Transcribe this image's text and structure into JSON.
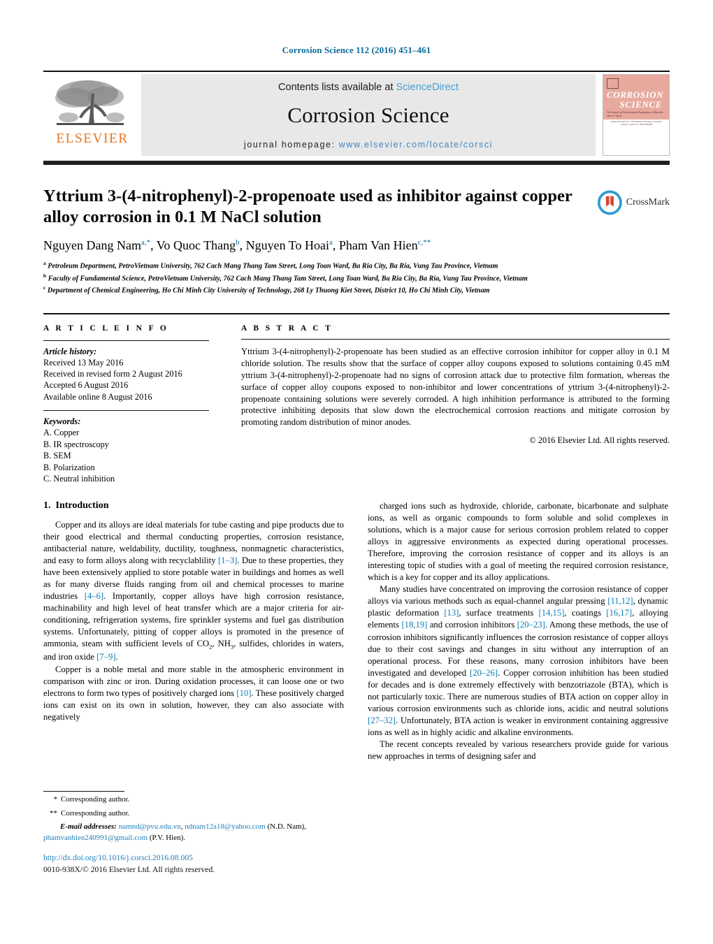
{
  "running_head": "Corrosion Science 112 (2016) 451–461",
  "masthead": {
    "publisher_name": "ELSEVIER",
    "contents_prefix": "Contents lists available at ",
    "contents_link": "ScienceDirect",
    "journal_name": "Corrosion Science",
    "homepage_label": "journal homepage: ",
    "homepage_url": "www.elsevier.com/locate/corsci",
    "cover": {
      "title_line1": "CORROSION",
      "title_line2": "SCIENCE",
      "subtitle": "The Journal on Environmental Degradation of Materials and its Control",
      "editors": "Editors-in-Chief: R.C. NEWMAN, University of Toronto, Canada, Canada   A.J. DAVENPORT"
    }
  },
  "article": {
    "title": "Yttrium 3-(4-nitrophenyl)-2-propenoate used as inhibitor against copper alloy corrosion in 0.1 M NaCl solution",
    "crossmark_label": "CrossMark",
    "authors_html": "Nguyen Dang Nam<sup>a,*</sup>, Vo Quoc Thang<sup>b</sup>, Nguyen To Hoai<sup>a</sup>, Pham Van Hien<sup>c,**</sup>",
    "affiliations": [
      "Petroleum Department, PetroVietnam University, 762 Cach Mang Thang Tam Street, Long Toan Ward, Ba Ria City, Ba Ria, Vung Tau Province, Vietnam",
      "Faculty of Fundamental Science, PetroVietnam University, 762 Cach Mang Thang Tam Street, Long Toan Ward, Ba Ria City, Ba Ria, Vung Tau Province, Vietnam",
      "Department of Chemical Engineering, Ho Chi Minh City University of Technology, 268 Ly Thuong Kiet Street, District 10, Ho Chi Minh City, Vietnam"
    ],
    "affiliation_marks": [
      "a",
      "b",
      "c"
    ]
  },
  "article_info": {
    "heading": "A R T I C L E   I N F O",
    "history_label": "Article history:",
    "history": [
      "Received 13 May 2016",
      "Received in revised form 2 August 2016",
      "Accepted 6 August 2016",
      "Available online 8 August 2016"
    ],
    "keywords_label": "Keywords:",
    "keywords": [
      "A. Copper",
      "B. IR spectroscopy",
      "B. SEM",
      "B. Polarization",
      "C. Neutral inhibition"
    ]
  },
  "abstract": {
    "heading": "A B S T R A C T",
    "text": "Yttrium 3-(4-nitrophenyl)-2-propenoate has been studied as an effective corrosion inhibitor for copper alloy in 0.1 M chloride solution. The results show that the surface of copper alloy coupons exposed to solutions containing 0.45 mM yttrium 3-(4-nitrophenyl)-2-propenoate had no signs of corrosion attack due to protective film formation, whereas the surface of copper alloy coupons exposed to non-inhibitor and lower concentrations of yttrium 3-(4-nitrophenyl)-2-propenoate containing solutions were severely corroded. A high inhibition performance is attributed to the forming protective inhibiting deposits that slow down the electrochemical corrosion reactions and mitigate corrosion by promoting random distribution of minor anodes.",
    "copyright": "© 2016 Elsevier Ltd. All rights reserved."
  },
  "body": {
    "section_number": "1.",
    "section_title": "Introduction",
    "left_paragraphs_html": [
      "Copper and its alloys are ideal materials for tube casting and pipe products due to their good electrical and thermal conducting properties, corrosion resistance, antibacterial nature, weldability, ductility, toughness, nonmagnetic characteristics, and easy to form alloys along with recyclablility <span class=\"ref\">[1–3]</span>. Due to these properties, they have been extensively applied to store potable water in buildings and homes as well as for many diverse fluids ranging from oil and chemical processes to marine industries <span class=\"ref\">[4–6]</span>. Importantly, copper alloys have high corrosion resistance, machinability and high level of heat transfer which are a major criteria for air-conditioning, refrigeration systems, fire sprinkler systems and fuel gas distribution systems. Unfortunately, pitting of copper alloys is promoted in the presence of ammonia, steam with sufficient levels of CO<sub>2</sub>, NH<sub>3</sub>, sulfides, chlorides in waters, and iron oxide <span class=\"ref\">[7–9]</span>.",
      "Copper is a noble metal and more stable in the atmospheric environment in comparison with zinc or iron. During oxidation processes, it can loose one or two electrons to form two types of positively charged ions <span class=\"ref\">[10]</span>. These positively charged ions can exist on its own in solution, however, they can also associate with negatively"
    ],
    "right_paragraphs_html": [
      "charged ions such as hydroxide, chloride, carbonate, bicarbonate and sulphate ions, as well as organic compounds to form soluble and solid complexes in solutions, which is a major cause for serious corrosion problem related to copper alloys in aggressive environments as expected during operational processes. Therefore, improving the corrosion resistance of copper and its alloys is an interesting topic of studies with a goal of meeting the required corrosion resistance, which is a key for copper and its alloy applications.",
      "Many studies have concentrated on improving the corrosion resistance of copper alloys via various methods such as equal-channel angular pressing <span class=\"ref\">[11,12]</span>, dynamic plastic deformation <span class=\"ref\">[13]</span>, surface treatments <span class=\"ref\">[14,15]</span>, coatings <span class=\"ref\">[16,17]</span>, alloying elements <span class=\"ref\">[18,19]</span> and corrosion inhibitors <span class=\"ref\">[20–23]</span>. Among these methods, the use of corrosion inhibitors significantly influences the corrosion resistance of copper alloys due to their cost savings and changes in situ without any interruption of an operational process. For these reasons, many corrosion inhibitors have been investigated and developed <span class=\"ref\">[20–26]</span>. Copper corrosion inhibition has been studied for decades and is done extremely effectively with benzotriazole (BTA), which is not particularly toxic. There are numerous studies of BTA action on copper alloy in various corrosion environments such as chloride ions, acidic and neutral solutions <span class=\"ref\">[27–32]</span>. Unfortunately, BTA action is weaker in environment containing aggressive ions as well as in highly acidic and alkaline environments.",
      "The recent concepts revealed by various researchers provide guide for various new approaches in terms of designing safer and"
    ]
  },
  "footnotes": {
    "corresponding_1_mark": "*",
    "corresponding_1": "Corresponding author.",
    "corresponding_2_mark": "**",
    "corresponding_2": "Corresponding author.",
    "email_label": "E-mail addresses:",
    "email_1": "namnd@pvu.edu.vn",
    "email_2": "ndnam12a18@yahoo.com",
    "email_1_owner": "(N.D. Nam),",
    "email_3": "phamvanhien240991@gmail.com",
    "email_3_owner": "(P.V. Hien).",
    "doi": "http://dx.doi.org/10.1016/j.corsci.2016.08.005",
    "issn_copyright": "0010-938X/© 2016 Elsevier Ltd. All rights reserved."
  },
  "colors": {
    "link_blue": "#1f7fb8",
    "ref_blue": "#0b7cb5",
    "elsevier_orange": "#e87722",
    "cover_pink": "#e7a99e",
    "masthead_grey": "#e8e8e8"
  }
}
